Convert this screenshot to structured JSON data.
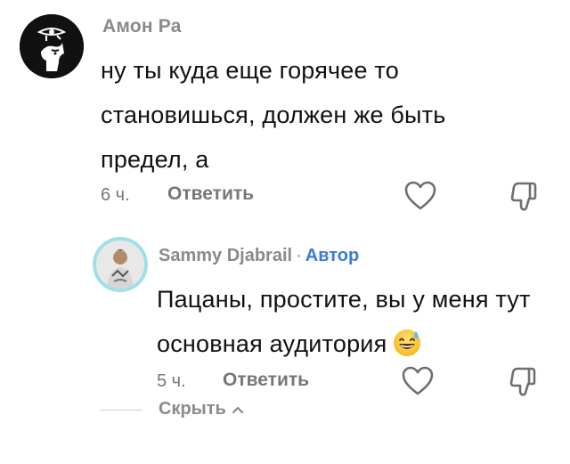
{
  "comment": {
    "author": "Амон Ра",
    "text": "ну ты куда еще горячее то становишься, должен же быть предел, а",
    "time": "6 ч.",
    "reply_label": "Ответить",
    "like_icon": "heart-outline-icon",
    "dislike_icon": "thumbs-down-outline-icon"
  },
  "reply": {
    "author": "Sammy Djabrail",
    "separator": "·",
    "badge": "Автор",
    "text": "Пацаны, простите, вы у меня тут основная аудитория",
    "emoji": "grinning-face-with-sweat-emoji",
    "time": "5 ч.",
    "reply_label": "Ответить",
    "like_icon": "heart-outline-icon",
    "dislike_icon": "thumbs-down-outline-icon",
    "avatar_ring_color": "#9ee0e3"
  },
  "hide": {
    "label": "Скрыть",
    "icon": "chevron-up-icon"
  },
  "colors": {
    "meta_text": "#8a8a8a",
    "body_text": "#111111",
    "author_badge": "#3a7bd5"
  }
}
